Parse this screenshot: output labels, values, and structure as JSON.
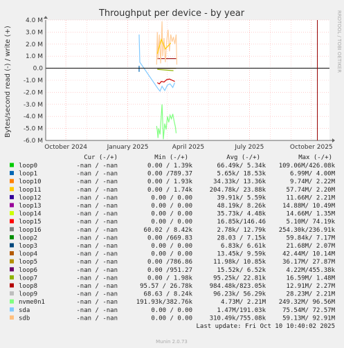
{
  "chart_data": {
    "type": "line",
    "title": "Throughput per device - by year",
    "ylabel": "Bytes/second read (-) / write (+)",
    "side_label": "RRDTOOL / TOBI OETIKER",
    "ylim": [
      -6000000,
      4000000
    ],
    "y_ticks": [
      {
        "value": 4000000,
        "label": "4.0 M"
      },
      {
        "value": 3000000,
        "label": "3.0 M"
      },
      {
        "value": 2000000,
        "label": "2.0 M"
      },
      {
        "value": 1000000,
        "label": "1.0 M"
      },
      {
        "value": 0,
        "label": "0.0"
      },
      {
        "value": -1000000,
        "label": "-1.0 M"
      },
      {
        "value": -2000000,
        "label": "-2.0 M"
      },
      {
        "value": -3000000,
        "label": "-3.0 M"
      },
      {
        "value": -4000000,
        "label": "-4.0 M"
      },
      {
        "value": -5000000,
        "label": "-5.0 M"
      },
      {
        "value": -6000000,
        "label": "-6.0 M"
      }
    ],
    "xlim": [
      "2024-09-01",
      "2025-10-28"
    ],
    "x_ticks": [
      {
        "date": "2024-10-01",
        "label": "October 2024"
      },
      {
        "date": "2025-01-01",
        "label": "January 2025"
      },
      {
        "date": "2025-04-01",
        "label": "April 2025"
      },
      {
        "date": "2025-07-01",
        "label": "July 2025"
      },
      {
        "date": "2025-10-01",
        "label": "October 2025"
      }
    ],
    "grid": true,
    "now_marker": "2025-10-10",
    "series": [
      {
        "name": "loop1",
        "color": "#0066b3",
        "points": [
          [
            "2025-01-18",
            200000
          ],
          [
            "2025-01-18",
            -300000
          ]
        ]
      },
      {
        "name": "loop12",
        "color": "#330099",
        "points": [
          [
            "2025-02-14",
            0
          ],
          [
            "2025-02-16",
            0
          ],
          [
            "2025-02-20",
            0
          ],
          [
            "2025-03-05",
            0
          ]
        ]
      },
      {
        "name": "loop8",
        "color": "#cc0000",
        "points": [
          [
            "2025-02-14",
            -1200000
          ],
          [
            "2025-02-17",
            -1300000
          ],
          [
            "2025-02-20",
            -1100000
          ],
          [
            "2025-02-24",
            -1150000
          ],
          [
            "2025-02-28",
            -950000
          ],
          [
            "2025-03-04",
            -900000
          ],
          [
            "2025-03-08",
            -1000000
          ],
          [
            "2025-03-12",
            -1100000
          ]
        ]
      },
      {
        "name": "loop15",
        "color": "#990000",
        "points": [
          [
            "2025-02-14",
            800000
          ],
          [
            "2025-03-14",
            800000
          ]
        ]
      },
      {
        "name": "sdb",
        "color": "#ffcc99",
        "points": [
          [
            "2025-02-13",
            300000
          ],
          [
            "2025-02-14",
            3000000
          ],
          [
            "2025-02-15",
            800000
          ],
          [
            "2025-02-17",
            2800000
          ],
          [
            "2025-02-19",
            400000
          ],
          [
            "2025-02-21",
            3900000
          ],
          [
            "2025-02-22",
            1000000
          ],
          [
            "2025-02-24",
            2500000
          ],
          [
            "2025-02-26",
            500000
          ],
          [
            "2025-02-28",
            2300000
          ],
          [
            "2025-03-02",
            3200000
          ],
          [
            "2025-03-04",
            1400000
          ],
          [
            "2025-03-06",
            2800000
          ],
          [
            "2025-03-08",
            2200000
          ],
          [
            "2025-03-10",
            2600000
          ],
          [
            "2025-03-12",
            2000000
          ],
          [
            "2025-03-14",
            2800000
          ],
          [
            "2025-03-15",
            300000
          ]
        ]
      },
      {
        "name": "nvme0n1",
        "color": "#80ff80",
        "points": [
          [
            "2025-02-13",
            -4800000
          ],
          [
            "2025-02-14",
            -5200000
          ],
          [
            "2025-02-15",
            -5800000
          ],
          [
            "2025-02-16",
            -5000000
          ],
          [
            "2025-02-18",
            -5500000
          ],
          [
            "2025-02-21",
            -3000000
          ],
          [
            "2025-02-23",
            -5900000
          ],
          [
            "2025-02-25",
            -4600000
          ],
          [
            "2025-02-27",
            -5100000
          ],
          [
            "2025-03-01",
            -4000000
          ],
          [
            "2025-03-03",
            -4500000
          ],
          [
            "2025-03-05",
            -3900000
          ],
          [
            "2025-03-07",
            -4200000
          ],
          [
            "2025-03-09",
            -3800000
          ],
          [
            "2025-03-11",
            -4400000
          ],
          [
            "2025-03-13",
            -4900000
          ],
          [
            "2025-03-14",
            -5400000
          ]
        ]
      },
      {
        "name": "sda",
        "color": "#80c9ff",
        "points": [
          [
            "2025-01-18",
            2800000
          ],
          [
            "2025-01-19",
            500000
          ],
          [
            "2025-02-15",
            -1700000
          ],
          [
            "2025-02-18",
            -1900000
          ],
          [
            "2025-02-21",
            -1500000
          ],
          [
            "2025-02-25",
            -1850000
          ],
          [
            "2025-03-01",
            -1400000
          ],
          [
            "2025-03-05",
            -1300000
          ],
          [
            "2025-03-09",
            -1600000
          ],
          [
            "2025-03-12",
            -1200000
          ]
        ]
      },
      {
        "name": "loop11",
        "color": "#ffcc00",
        "points": [
          [
            "2025-02-14",
            1200000
          ],
          [
            "2025-02-20",
            2400000
          ],
          [
            "2025-02-26",
            1600000
          ],
          [
            "2025-03-06",
            2100000
          ]
        ]
      },
      {
        "name": "loop7",
        "color": "#8fb300",
        "points": [
          [
            "2025-02-14",
            -100000
          ],
          [
            "2025-03-10",
            -200000
          ]
        ]
      },
      {
        "name": "loop5",
        "color": "#b8860b",
        "points": [
          [
            "2025-02-14",
            0
          ],
          [
            "2025-03-14",
            0
          ]
        ]
      }
    ]
  },
  "legend": {
    "header": {
      "cur": "Cur (-/+)",
      "min": "Min (-/+)",
      "avg": "Avg (-/+)",
      "max": "Max (-/+)"
    },
    "rows": [
      {
        "name": "loop0",
        "color": "#00cc00",
        "cur": "-nan /  -nan",
        "min": "0.00 /  1.39k",
        "avg": "66.49k/  5.34k",
        "max": "109.06M/426.08k"
      },
      {
        "name": "loop1",
        "color": "#0066b3",
        "cur": "-nan /  -nan",
        "min": "0.00 /789.37",
        "avg": "5.65k/ 18.53k",
        "max": "6.99M/  4.00M"
      },
      {
        "name": "loop10",
        "color": "#ff8000",
        "cur": "-nan /  -nan",
        "min": "0.00 /  1.93k",
        "avg": "34.33k/ 13.36k",
        "max": "9.74M/  2.22M"
      },
      {
        "name": "loop11",
        "color": "#ffcc00",
        "cur": "-nan /  -nan",
        "min": "0.00 /  1.74k",
        "avg": "204.78k/ 23.88k",
        "max": "57.74M/  2.20M"
      },
      {
        "name": "loop12",
        "color": "#330099",
        "cur": "-nan /  -nan",
        "min": "0.00 /  0.00",
        "avg": "39.91k/  5.59k",
        "max": "11.66M/  2.21M"
      },
      {
        "name": "loop13",
        "color": "#990099",
        "cur": "-nan /  -nan",
        "min": "0.00 /  0.00",
        "avg": "48.19k/  8.26k",
        "max": "14.88M/ 10.49M"
      },
      {
        "name": "loop14",
        "color": "#ccff00",
        "cur": "-nan /  -nan",
        "min": "0.00 /  0.00",
        "avg": "35.73k/  4.48k",
        "max": "14.66M/  1.35M"
      },
      {
        "name": "loop15",
        "color": "#ff0000",
        "cur": "-nan /  -nan",
        "min": "0.00 /  0.00",
        "avg": "16.85k/146.46",
        "max": "5.10M/ 74.19k"
      },
      {
        "name": "loop16",
        "color": "#808080",
        "cur": "-nan /  -nan",
        "min": "60.02 /  8.42k",
        "avg": "2.78k/ 12.79k",
        "max": "254.30k/236.91k"
      },
      {
        "name": "loop2",
        "color": "#008f00",
        "cur": "-nan /  -nan",
        "min": "0.00 /669.83",
        "avg": "28.03 /  7.15k",
        "max": "59.84k/  7.17M"
      },
      {
        "name": "loop3",
        "color": "#00487d",
        "cur": "-nan /  -nan",
        "min": "0.00 /  0.00",
        "avg": "6.83k/  6.61k",
        "max": "21.68M/  2.07M"
      },
      {
        "name": "loop4",
        "color": "#b35a00",
        "cur": "-nan /  -nan",
        "min": "0.00 /  0.00",
        "avg": "13.45k/  9.59k",
        "max": "42.44M/ 10.14M"
      },
      {
        "name": "loop5",
        "color": "#b38f00",
        "cur": "-nan /  -nan",
        "min": "0.00 /786.86",
        "avg": "11.98k/ 10.85k",
        "max": "36.17M/ 27.87M"
      },
      {
        "name": "loop6",
        "color": "#6b006b",
        "cur": "-nan /  -nan",
        "min": "0.00 /951.27",
        "avg": "15.52k/  6.52k",
        "max": "4.22M/455.38k"
      },
      {
        "name": "loop7",
        "color": "#8fb300",
        "cur": "-nan /  -nan",
        "min": "0.00 /  1.98k",
        "avg": "95.25k/ 22.81k",
        "max": "16.59M/  1.48M"
      },
      {
        "name": "loop8",
        "color": "#b30000",
        "cur": "-nan /  -nan",
        "min": "95.57 / 26.78k",
        "avg": "984.48k/823.05k",
        "max": "12.91M/  2.27M"
      },
      {
        "name": "loop9",
        "color": "#bebebe",
        "cur": "-nan /  -nan",
        "min": "68.63 /  8.24k",
        "avg": "96.23k/ 56.29k",
        "max": "28.23M/  2.21M"
      },
      {
        "name": "nvme0n1",
        "color": "#80ff80",
        "cur": "-nan /  -nan",
        "min": "191.93k/382.76k",
        "avg": "4.73M/  2.21M",
        "max": "249.32M/ 96.56M"
      },
      {
        "name": "sda",
        "color": "#80c9ff",
        "cur": "-nan /  -nan",
        "min": "0.00 /  0.00",
        "avg": "1.47M/191.03k",
        "max": "75.54M/ 72.57M"
      },
      {
        "name": "sdb",
        "color": "#ffc080",
        "cur": "-nan /  -nan",
        "min": "0.00 /  0.00",
        "avg": "310.49k/755.08k",
        "max": "59.13M/ 92.91M"
      }
    ],
    "last_update": "Last update: Fri Oct 10 10:40:02 2025"
  },
  "footer": "Munin 2.0.73",
  "colors": {
    "grid": "#ffb0b0",
    "axis": "#000000",
    "now": "#990000",
    "background": "#f0f0f0",
    "plot": "#ffffff"
  }
}
